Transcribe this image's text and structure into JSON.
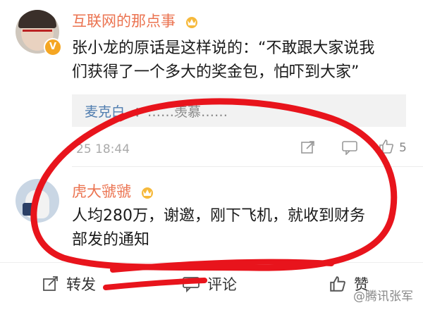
{
  "comment1": {
    "username": "互联网的那点事",
    "verified_badge": "V",
    "text_line1": "张小龙的原话是这样说的：“不敢跟大家说我",
    "text_line2": "们获得了一个多大的奖金包，怕吓到大家”",
    "reply": {
      "name": "麦克白",
      "rest": "：……羡慕……"
    },
    "timestamp": "25 18:44",
    "like_count": "5",
    "icons": [
      "share-icon",
      "comment-icon",
      "like-icon"
    ]
  },
  "comment2": {
    "username": "虎大虢虢",
    "text_line1": "人均280万，谢邀，刚下飞机，就收到财务",
    "text_line2": "部发的通知"
  },
  "actions": {
    "repost": "转发",
    "comment": "评论",
    "like": "赞"
  },
  "watermark": "@腾讯张军",
  "colors": {
    "username": "#eb7350",
    "reply_name": "#507daf",
    "annotation": "#e8141c"
  }
}
